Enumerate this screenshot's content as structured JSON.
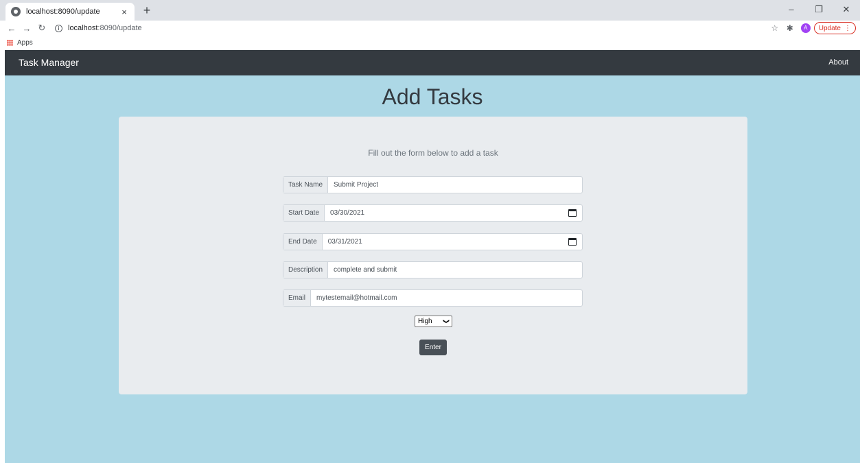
{
  "browser": {
    "tab_title": "localhost:8090/update",
    "tab_close": "×",
    "new_tab": "+",
    "url_host": "localhost",
    "url_path": ":8090/update",
    "update_label": "Update",
    "avatar_letter": "A",
    "bookmarks": {
      "apps_label": "Apps"
    }
  },
  "navbar": {
    "brand": "Task Manager",
    "about": "About"
  },
  "main": {
    "heading": "Add Tasks",
    "lead": "Fill out the form below to add a task",
    "fields": [
      {
        "label": "Task Name",
        "value": "Submit Project"
      },
      {
        "label": "Start Date",
        "value": "03/30/2021"
      },
      {
        "label": "End Date",
        "value": "03/31/2021"
      },
      {
        "label": "Description",
        "value": "complete and submit"
      },
      {
        "label": "Email",
        "value": "mytestemail@hotmail.com"
      }
    ],
    "priority": {
      "selected": "High"
    },
    "enter_label": "Enter"
  },
  "icons": [
    "globe-icon",
    "back-icon",
    "forward-icon",
    "reload-icon",
    "info-icon",
    "star-icon",
    "extensions-icon",
    "menu-icon",
    "apps-icon",
    "calendar-icon",
    "chevron-down-icon"
  ]
}
